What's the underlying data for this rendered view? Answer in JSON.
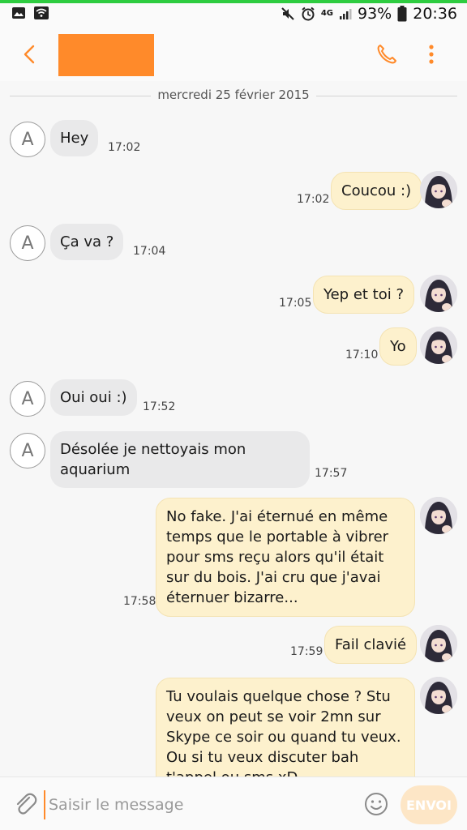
{
  "status_bar": {
    "network": "4G",
    "battery": "93%",
    "time": "20:36"
  },
  "header": {
    "contact_name": "",
    "accent_color": "#ff8a2a"
  },
  "conversation": {
    "date": "mercredi 25 février 2015",
    "messages": [
      {
        "direction": "in",
        "text": "Hey",
        "time": "17:02"
      },
      {
        "direction": "out",
        "text": "Coucou :)",
        "time": "17:02"
      },
      {
        "direction": "in",
        "text": "Ça va ?",
        "time": "17:04"
      },
      {
        "direction": "out",
        "text": "Yep et toi ?",
        "time": "17:05"
      },
      {
        "direction": "out",
        "text": "Yo",
        "time": "17:10"
      },
      {
        "direction": "in",
        "text": "Oui oui :)",
        "time": "17:52"
      },
      {
        "direction": "in",
        "text": "Désolée je nettoyais mon aquarium",
        "time": "17:57"
      },
      {
        "direction": "out",
        "text": "No fake. J'ai éternué en même temps que le portable à vibrer pour sms reçu alors qu'il était sur du bois. J'ai cru que j'avai éternuer bizarre...",
        "time": "17:58"
      },
      {
        "direction": "out",
        "text": "Fail clavié",
        "time": "17:59"
      },
      {
        "direction": "out",
        "text": "Tu voulais quelque chose ? Stu veux on peut se voir 2mn sur Skype ce soir ou quand tu veux. Ou si tu veux discuter bah t'appel ou sms xD",
        "time": ""
      }
    ],
    "incoming_avatar_letter": "A"
  },
  "composer": {
    "placeholder": "Saisir le message",
    "send_label": "ENVOI"
  }
}
